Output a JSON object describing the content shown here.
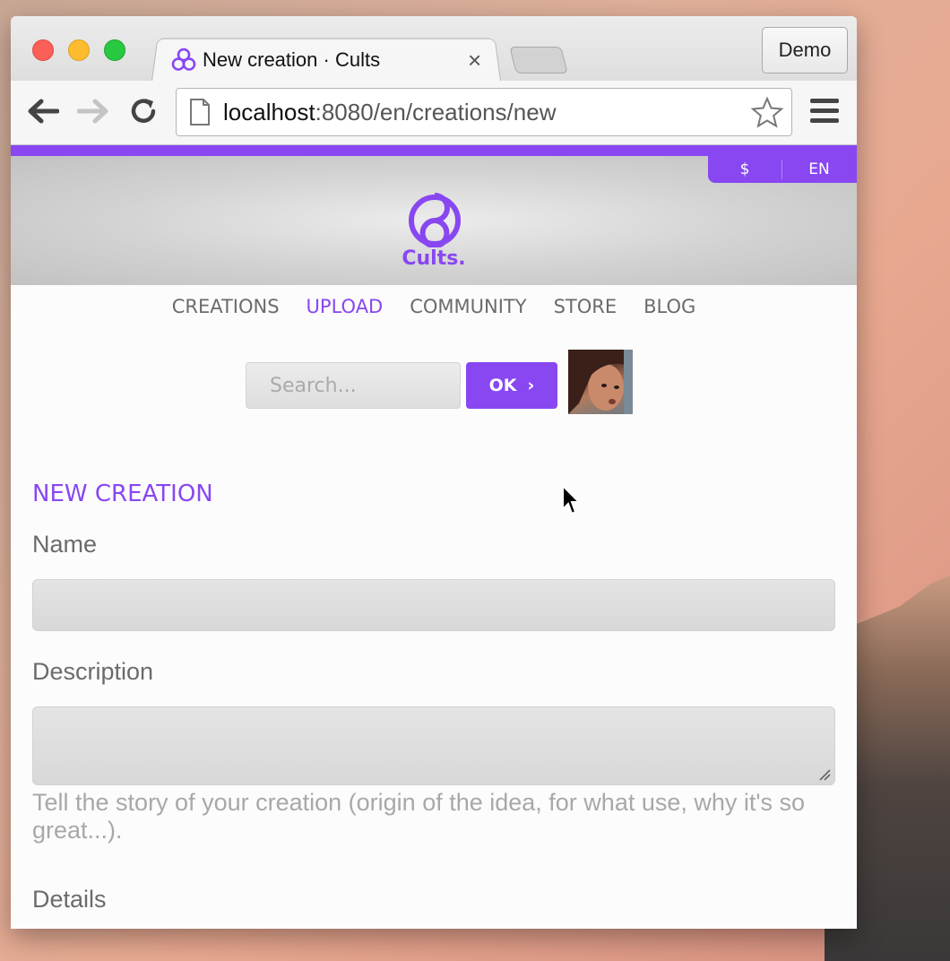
{
  "browser": {
    "tab_title": "New creation · Cults",
    "tab_close": "×",
    "profile": "Demo",
    "url_host": "localhost",
    "url_rest": ":8080/en/creations/new"
  },
  "header": {
    "currency": "$",
    "language": "EN",
    "logo_text": "Cults."
  },
  "nav": {
    "items": [
      {
        "label": "CREATIONS",
        "active": false
      },
      {
        "label": "UPLOAD",
        "active": true
      },
      {
        "label": "COMMUNITY",
        "active": false
      },
      {
        "label": "STORE",
        "active": false
      },
      {
        "label": "BLOG",
        "active": false
      }
    ]
  },
  "search": {
    "placeholder": "Search...",
    "button_label": "OK",
    "button_chevron": "›"
  },
  "form": {
    "section_title": "NEW CREATION",
    "name_label": "Name",
    "description_label": "Description",
    "description_help": "Tell the story of your creation (origin of the idea, for what use, why it's so great...).",
    "details_label": "Details"
  },
  "colors": {
    "brand_purple": "#8847f1",
    "label_gray": "#6b6b6b"
  }
}
